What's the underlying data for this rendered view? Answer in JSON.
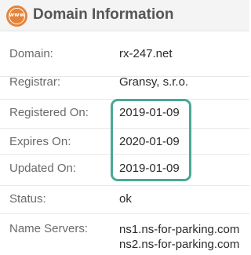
{
  "header": {
    "icon_label": "www",
    "title": "Domain Information"
  },
  "rows": [
    {
      "label": "Domain:",
      "value": "rx-247.net"
    },
    {
      "label": "Registrar:",
      "value": "Gransy, s.r.o."
    },
    {
      "label": "Registered On:",
      "value": "2019-01-09"
    },
    {
      "label": "Expires On:",
      "value": "2020-01-09"
    },
    {
      "label": "Updated On:",
      "value": "2019-01-09"
    },
    {
      "label": "Status:",
      "value": "ok"
    },
    {
      "label": "Name Servers:",
      "values": [
        "ns1.ns-for-parking.com",
        "ns2.ns-for-parking.com"
      ]
    }
  ],
  "colors": {
    "header_bg": "#f4f4f4",
    "icon_orange": "#e6833a",
    "highlight_teal": "#4aa896"
  }
}
